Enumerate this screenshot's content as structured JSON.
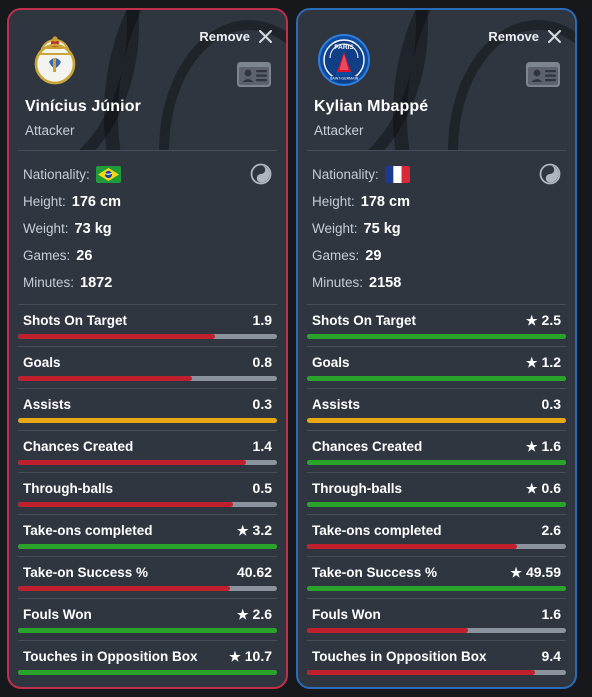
{
  "cards": [
    {
      "accent_color": "#c0304a",
      "crest_name": "real-madrid-crest",
      "remove_label": "Remove",
      "player_name": "Vinícius Júnior",
      "player_role": "Attacker",
      "bio": {
        "nationality_label": "Nationality:",
        "nationality_flag": "brazil-flag",
        "height_label": "Height:",
        "height_value": "176 cm",
        "weight_label": "Weight:",
        "weight_value": "73 kg",
        "games_label": "Games:",
        "games_value": "26",
        "minutes_label": "Minutes:",
        "minutes_value": "1872"
      },
      "stats": [
        {
          "label": "Shots On Target",
          "value": "1.9",
          "star": false,
          "pct": 76,
          "color": "#c0202e"
        },
        {
          "label": "Goals",
          "value": "0.8",
          "star": false,
          "pct": 67,
          "color": "#c0202e"
        },
        {
          "label": "Assists",
          "value": "0.3",
          "star": false,
          "pct": 100,
          "color": "#e8a813"
        },
        {
          "label": "Chances Created",
          "value": "1.4",
          "star": false,
          "pct": 88,
          "color": "#c0202e"
        },
        {
          "label": "Through-balls",
          "value": "0.5",
          "star": false,
          "pct": 83,
          "color": "#c0202e"
        },
        {
          "label": "Take-ons completed",
          "value": "3.2",
          "star": true,
          "pct": 100,
          "color": "#2aa32a"
        },
        {
          "label": "Take-on Success %",
          "value": "40.62",
          "star": false,
          "pct": 82,
          "color": "#c0202e"
        },
        {
          "label": "Fouls Won",
          "value": "2.6",
          "star": true,
          "pct": 100,
          "color": "#2aa32a"
        },
        {
          "label": "Touches in Opposition Box",
          "value": "10.7",
          "star": true,
          "pct": 100,
          "color": "#2aa32a"
        }
      ]
    },
    {
      "accent_color": "#2b6cb8",
      "crest_name": "psg-crest",
      "remove_label": "Remove",
      "player_name": "Kylian Mbappé",
      "player_role": "Attacker",
      "bio": {
        "nationality_label": "Nationality:",
        "nationality_flag": "france-flag",
        "height_label": "Height:",
        "height_value": "178 cm",
        "weight_label": "Weight:",
        "weight_value": "75 kg",
        "games_label": "Games:",
        "games_value": "29",
        "minutes_label": "Minutes:",
        "minutes_value": "2158"
      },
      "stats": [
        {
          "label": "Shots On Target",
          "value": "2.5",
          "star": true,
          "pct": 100,
          "color": "#2aa32a"
        },
        {
          "label": "Goals",
          "value": "1.2",
          "star": true,
          "pct": 100,
          "color": "#2aa32a"
        },
        {
          "label": "Assists",
          "value": "0.3",
          "star": false,
          "pct": 100,
          "color": "#e8a813"
        },
        {
          "label": "Chances Created",
          "value": "1.6",
          "star": true,
          "pct": 100,
          "color": "#2aa32a"
        },
        {
          "label": "Through-balls",
          "value": "0.6",
          "star": true,
          "pct": 100,
          "color": "#2aa32a"
        },
        {
          "label": "Take-ons completed",
          "value": "2.6",
          "star": false,
          "pct": 81,
          "color": "#c0202e"
        },
        {
          "label": "Take-on Success %",
          "value": "49.59",
          "star": true,
          "pct": 100,
          "color": "#2aa32a"
        },
        {
          "label": "Fouls Won",
          "value": "1.6",
          "star": false,
          "pct": 62,
          "color": "#c0202e"
        },
        {
          "label": "Touches in Opposition Box",
          "value": "9.4",
          "star": false,
          "pct": 88,
          "color": "#c0202e"
        }
      ]
    }
  ],
  "icons": {
    "close": "✕",
    "star": "★",
    "idcard": "id-card-icon",
    "circle": "club-badge-icon"
  }
}
